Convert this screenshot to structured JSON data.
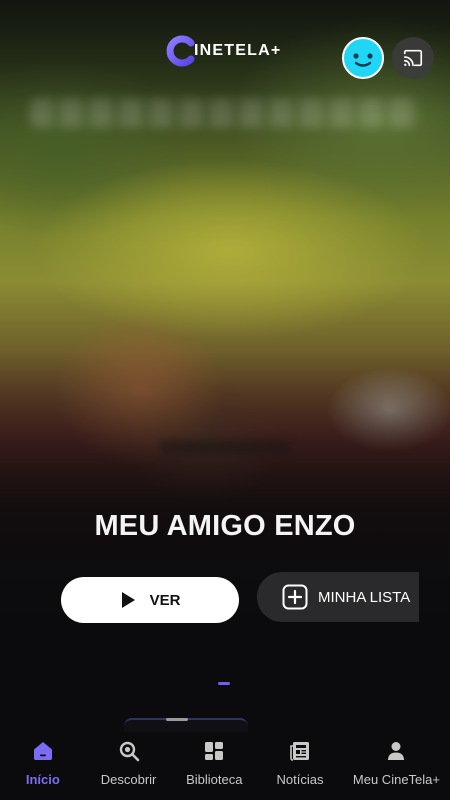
{
  "app": {
    "logo_text": "INETELA+",
    "brand_color": "#6e5cf5"
  },
  "header": {
    "avatar_icon": "smiley-avatar-icon",
    "cast_icon": "cast-icon"
  },
  "hero": {
    "title": "MEU AMIGO ENZO",
    "play_label": "VER",
    "my_list_label": "MINHA LISTA",
    "carousel_active_index": 1
  },
  "bottom_nav": {
    "items": [
      {
        "label": "Início",
        "icon": "home-icon",
        "active": true
      },
      {
        "label": "Descobrir",
        "icon": "search-icon",
        "active": false
      },
      {
        "label": "Biblioteca",
        "icon": "grid-icon",
        "active": false
      },
      {
        "label": "Notícias",
        "icon": "newspaper-icon",
        "active": false
      },
      {
        "label": "Meu CineTela+",
        "icon": "person-icon",
        "active": false
      }
    ],
    "active_color": "#7b6cf6",
    "inactive_color": "#c8c8c8"
  }
}
